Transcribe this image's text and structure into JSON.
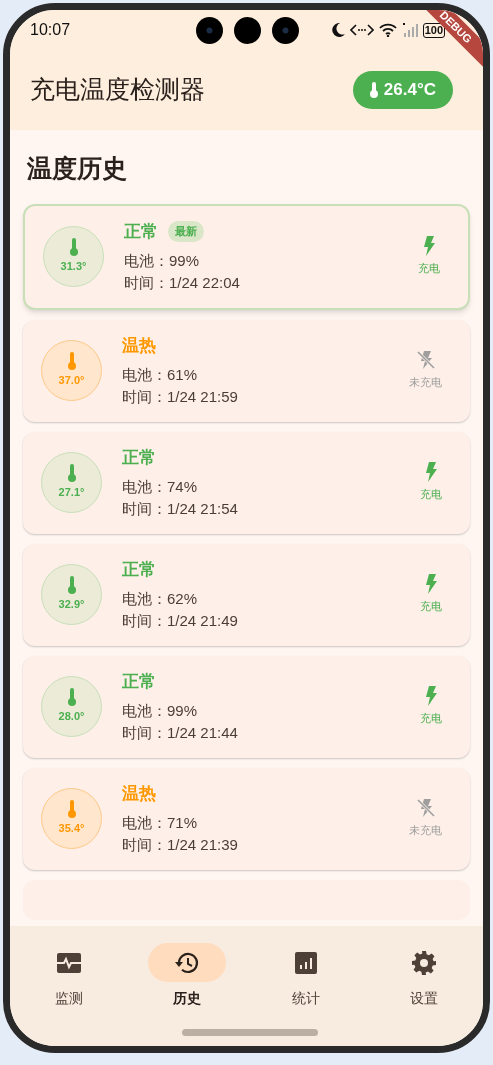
{
  "status_bar": {
    "time": "10:07",
    "battery": "100"
  },
  "debug_banner": "DEBUG",
  "app_bar": {
    "title": "充电温度检测器",
    "temperature": "26.4°C"
  },
  "section_title": "温度历史",
  "records": [
    {
      "kind": "normal",
      "status": "正常",
      "latest": true,
      "latest_label": "最新",
      "temperature": "31.3°",
      "battery": "电池：99%",
      "time": "时间：1/24 22:04",
      "charging": true,
      "charge_label": "充电"
    },
    {
      "kind": "warm",
      "status": "温热",
      "latest": false,
      "temperature": "37.0°",
      "battery": "电池：61%",
      "time": "时间：1/24 21:59",
      "charging": false,
      "charge_label": "未充电"
    },
    {
      "kind": "normal",
      "status": "正常",
      "latest": false,
      "temperature": "27.1°",
      "battery": "电池：74%",
      "time": "时间：1/24 21:54",
      "charging": true,
      "charge_label": "充电"
    },
    {
      "kind": "normal",
      "status": "正常",
      "latest": false,
      "temperature": "32.9°",
      "battery": "电池：62%",
      "time": "时间：1/24 21:49",
      "charging": true,
      "charge_label": "充电"
    },
    {
      "kind": "normal",
      "status": "正常",
      "latest": false,
      "temperature": "28.0°",
      "battery": "电池：99%",
      "time": "时间：1/24 21:44",
      "charging": true,
      "charge_label": "充电"
    },
    {
      "kind": "warm",
      "status": "温热",
      "latest": false,
      "temperature": "35.4°",
      "battery": "电池：71%",
      "time": "时间：1/24 21:39",
      "charging": false,
      "charge_label": "未充电"
    }
  ],
  "nav": [
    {
      "kind": "monitor",
      "label": "监测",
      "selected": false
    },
    {
      "kind": "history",
      "label": "历史",
      "selected": true
    },
    {
      "kind": "stats",
      "label": "统计",
      "selected": false
    },
    {
      "kind": "settings",
      "label": "设置",
      "selected": false
    }
  ]
}
